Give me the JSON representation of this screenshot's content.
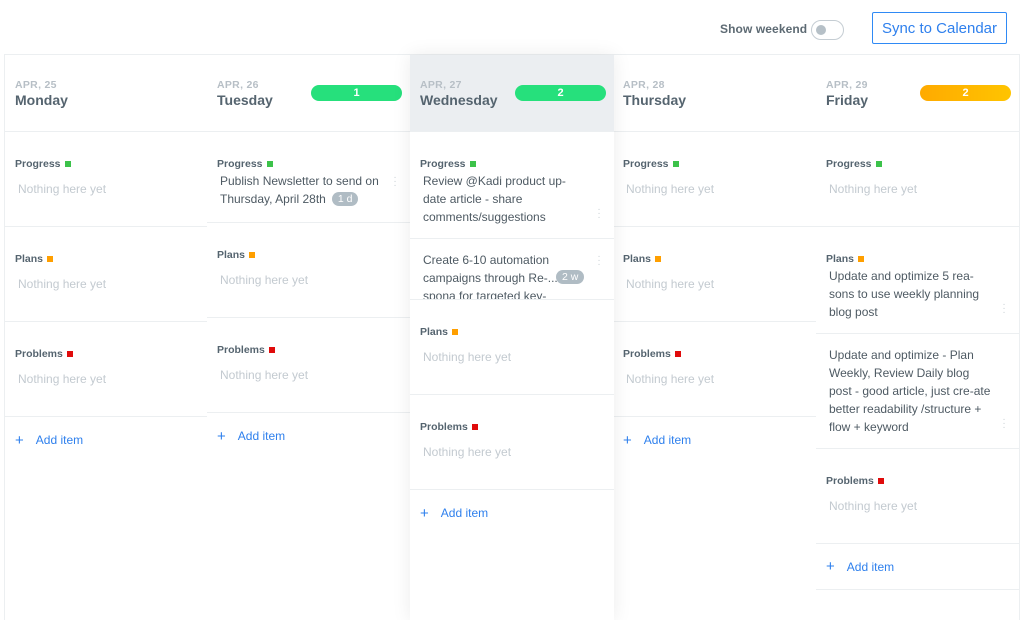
{
  "topbar": {
    "show_weekend_label": "Show weekend",
    "show_weekend_on": false,
    "sync_button": "Sync to Calendar"
  },
  "colors": {
    "progress": "#3cc24a",
    "plans": "#ff9f00",
    "problems": "#e00b0b",
    "accent": "#2f80ed",
    "count_green": "#26e07c",
    "count_orange": "#ffb300"
  },
  "labels": {
    "progress": "Progress",
    "plans": "Plans",
    "problems": "Problems",
    "empty": "Nothing here yet",
    "add_item": "Add item",
    "plus_icon": "+",
    "dots_icon": "⋮"
  },
  "days": [
    {
      "date": "APR, 25",
      "name": "Monday",
      "count": null,
      "progress": [],
      "plans": [],
      "problems": []
    },
    {
      "date": "APR, 26",
      "name": "Tuesday",
      "count": "1",
      "progress": [
        {
          "text": "Publish Newsletter to send on Thursday, April 28th",
          "badge": "1 d"
        }
      ],
      "plans": [],
      "problems": []
    },
    {
      "date": "APR, 27",
      "name": "Wednesday",
      "count": "2",
      "progress": [
        {
          "text": "Review @Kadi product up-date article - share comments/suggestions",
          "badge": null
        },
        {
          "text": "Create 6-10 automation campaigns through Re-... spona for targeted key-",
          "badge": "2 w"
        }
      ],
      "plans": [],
      "problems": []
    },
    {
      "date": "APR, 28",
      "name": "Thursday",
      "count": null,
      "progress": [],
      "plans": [],
      "problems": []
    },
    {
      "date": "APR, 29",
      "name": "Friday",
      "count": "2",
      "progress": [],
      "plans": [
        {
          "text": "Update and optimize 5 rea-sons to use weekly planning blog post",
          "badge": null
        },
        {
          "text": "Update and optimize - Plan Weekly, Review Daily blog post - good article, just cre-ate better readability /structure + flow + keyword",
          "badge": null
        }
      ],
      "problems": []
    }
  ]
}
